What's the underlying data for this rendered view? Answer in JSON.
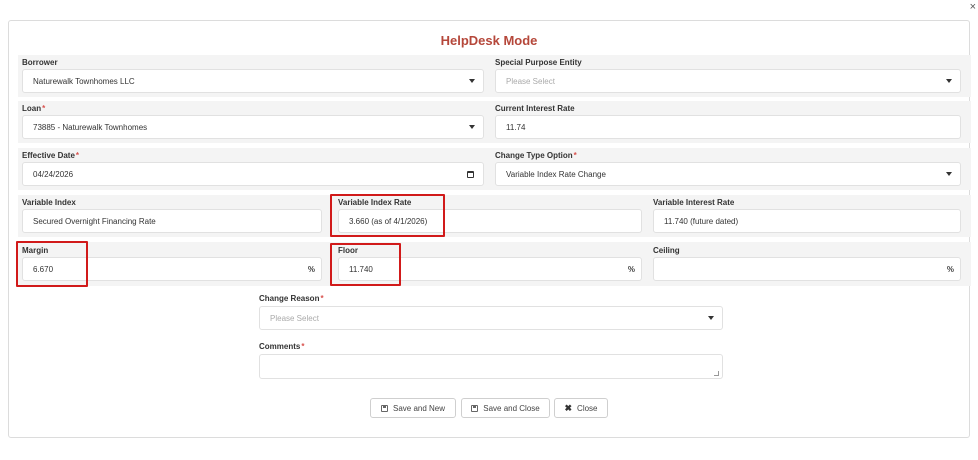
{
  "window": {
    "close_glyph": "×"
  },
  "title": "HelpDesk Mode",
  "fields": {
    "borrower": {
      "label": "Borrower",
      "value": "Naturewalk Townhomes LLC"
    },
    "spe": {
      "label": "Special Purpose Entity",
      "placeholder": "Please Select"
    },
    "loan": {
      "label": "Loan",
      "value": "73885 - Naturewalk Townhomes"
    },
    "current_rate": {
      "label": "Current Interest Rate",
      "value": "11.74"
    },
    "effective_date": {
      "label": "Effective Date",
      "value": "04/24/2026"
    },
    "change_type": {
      "label": "Change Type Option",
      "value": "Variable Index Rate Change"
    },
    "variable_index": {
      "label": "Variable Index",
      "value": "Secured Overnight Financing Rate"
    },
    "variable_index_rate": {
      "label": "Variable Index Rate",
      "value": "3.660 (as of 4/1/2026)"
    },
    "variable_interest_rate": {
      "label": "Variable Interest Rate",
      "value": "11.740 (future dated)"
    },
    "margin": {
      "label": "Margin",
      "value": "6.670",
      "unit": "%"
    },
    "floor": {
      "label": "Floor",
      "value": "11.740",
      "unit": "%"
    },
    "ceiling": {
      "label": "Ceiling",
      "value": "",
      "unit": "%"
    },
    "change_reason": {
      "label": "Change Reason",
      "placeholder": "Please Select"
    },
    "comments": {
      "label": "Comments",
      "value": ""
    }
  },
  "required_marker": "*",
  "buttons": {
    "save_new": "Save and New",
    "save_close": "Save and Close",
    "close": "Close",
    "close_icon": "✖"
  },
  "colors": {
    "title": "#b5473a",
    "highlight": "#d11a1a",
    "required": "#d9534f"
  }
}
